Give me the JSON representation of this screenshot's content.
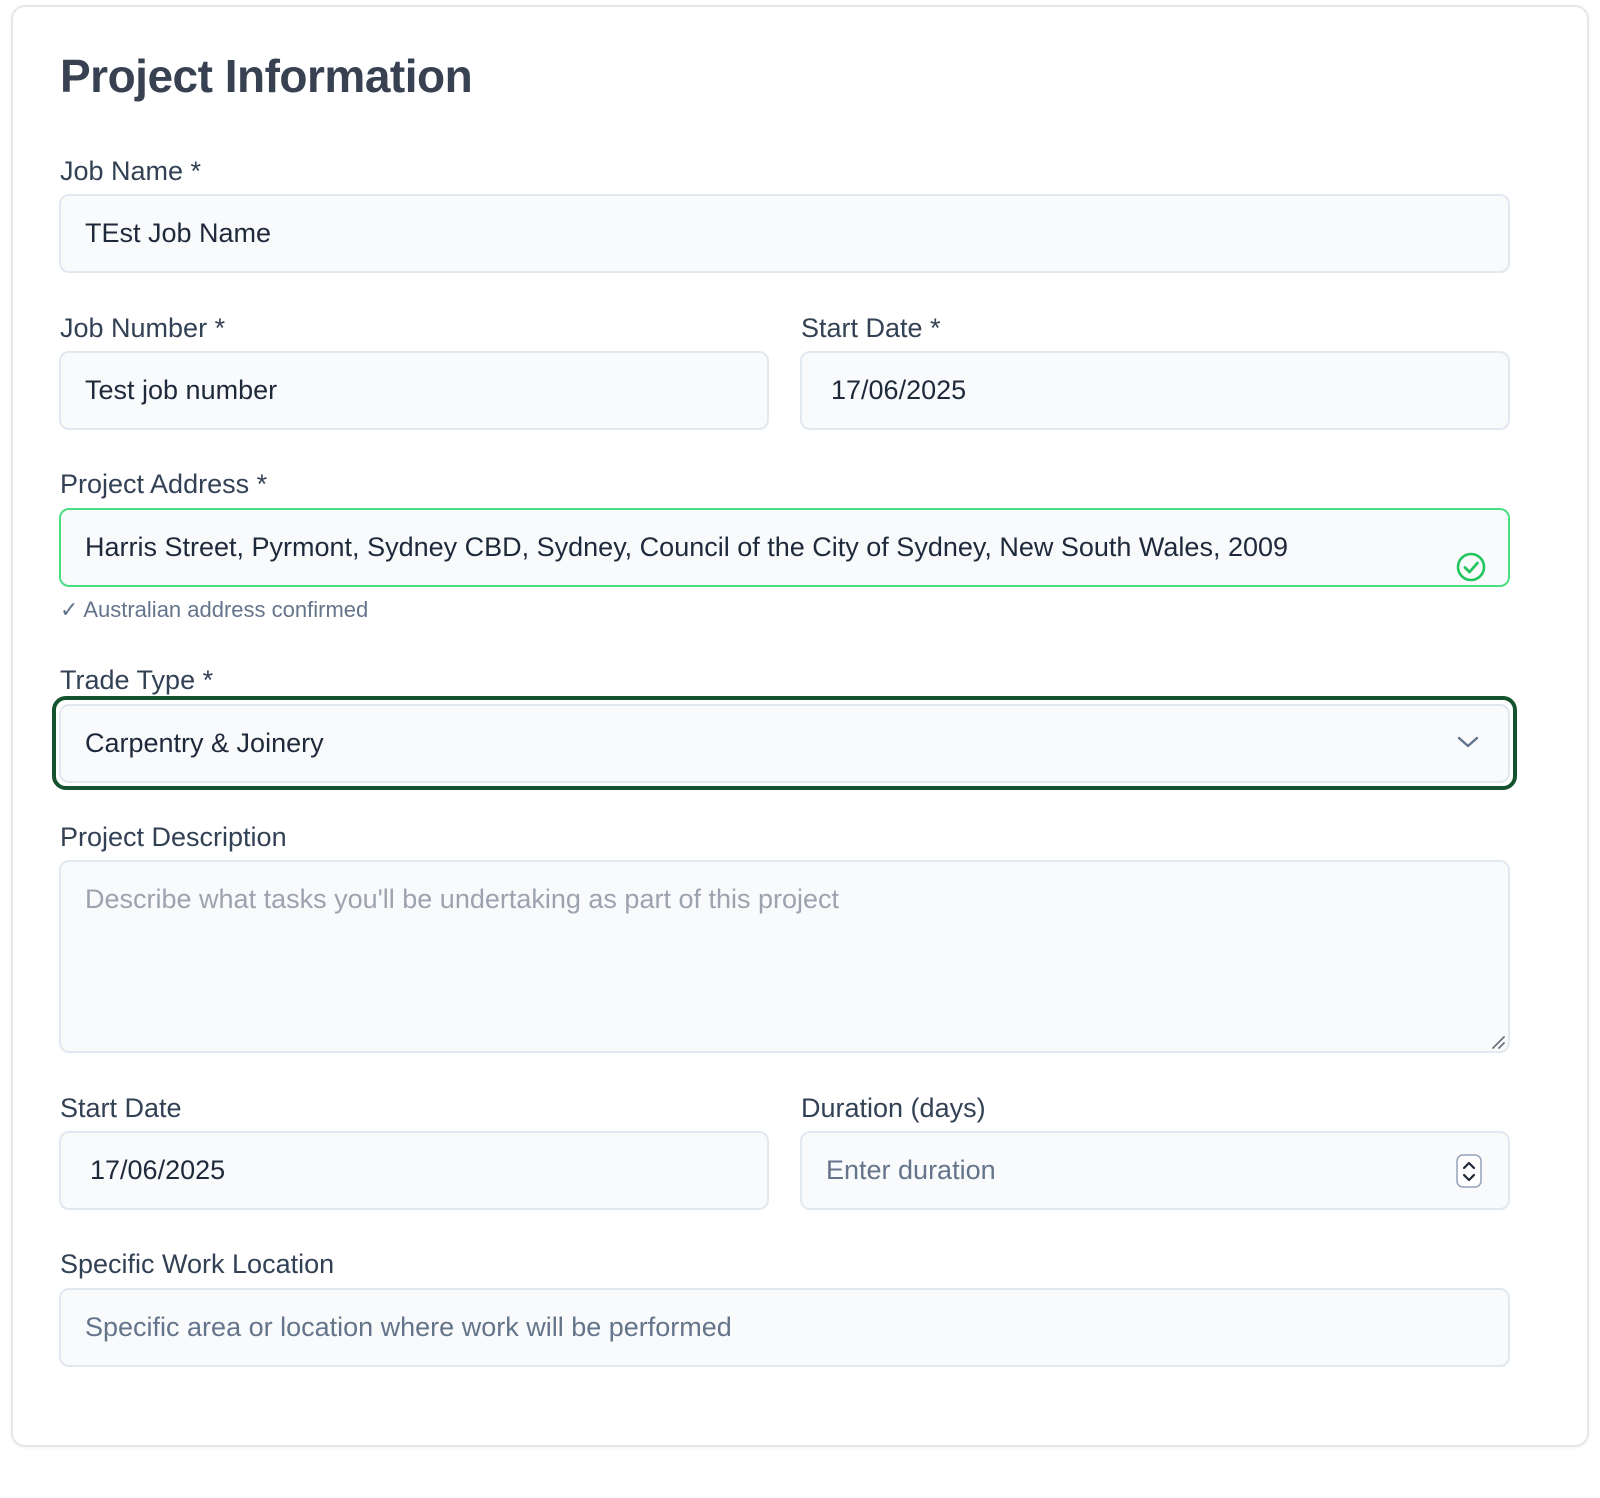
{
  "form": {
    "title": "Project Information",
    "job_name": {
      "label": "Job Name *",
      "value": "TEst Job Name"
    },
    "job_number": {
      "label": "Job Number *",
      "value": "Test job number"
    },
    "start_date_required": {
      "label": "Start Date *",
      "value": "17/06/2025"
    },
    "project_address": {
      "label": "Project Address *",
      "value": "Harris Street, Pyrmont, Sydney CBD, Sydney, Council of the City of Sydney, New South Wales, 2009",
      "status_icon": "check-circle-icon",
      "helper": "✓ Australian address confirmed",
      "status_color": "#22c55e"
    },
    "trade_type": {
      "label": "Trade Type *",
      "value": "Carpentry & Joinery",
      "icon": "chevron-down-icon",
      "focus_color": "#14532d"
    },
    "project_description": {
      "label": "Project Description",
      "placeholder": "Describe what tasks you'll be undertaking as part of this project"
    },
    "start_date": {
      "label": "Start Date",
      "value": "17/06/2025"
    },
    "duration": {
      "label": "Duration (days)",
      "placeholder": "Enter duration",
      "icon": "spinner-arrows-icon"
    },
    "work_location": {
      "label": "Specific Work Location",
      "placeholder": "Specific area or location where work will be performed"
    }
  }
}
